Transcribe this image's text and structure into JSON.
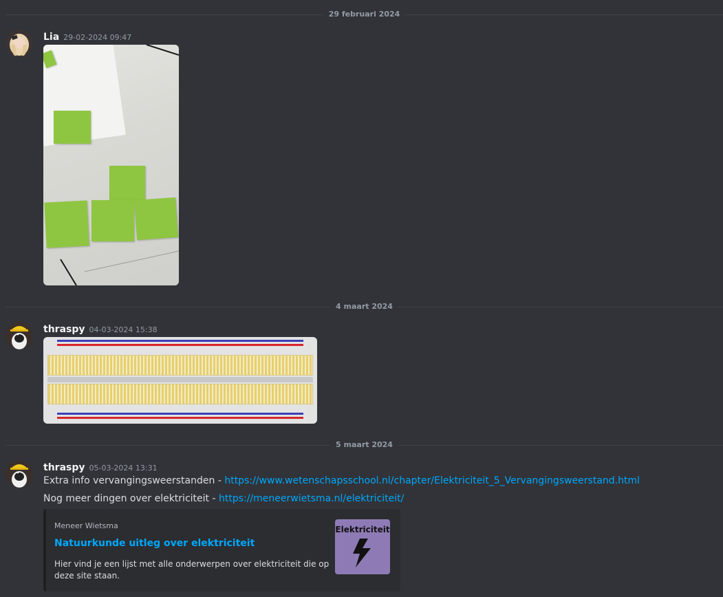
{
  "dividers": [
    "29 februari 2024",
    "4 maart 2024",
    "5 maart 2024"
  ],
  "messages": [
    {
      "author": "Lia",
      "timestamp": "29-02-2024 09:47",
      "avatar": "user-avatar",
      "attachment": "photo-sticky-notes"
    },
    {
      "author": "thraspy",
      "timestamp": "04-03-2024 15:38",
      "avatar": "penguin-hardhat-avatar",
      "attachment": "breadboard-image"
    },
    {
      "author": "thraspy",
      "timestamp": "05-03-2024 13:31",
      "avatar": "penguin-hardhat-avatar",
      "lines": [
        {
          "text": "Extra info vervangingsweerstanden - ",
          "link": "https://www.wetenschapsschool.nl/chapter/Elektriciteit_5_Vervangingsweerstand.html"
        },
        {
          "text": "Nog meer dingen over elektriciteit - ",
          "link": "https://meneerwietsma.nl/elektriciteit/"
        }
      ],
      "embed": {
        "provider": "Meneer Wietsma",
        "title": "Natuurkunde uitleg over elektriciteit",
        "description": "Hier vind je een lijst met alle onderwerpen over elektriciteit die op deze site staan.",
        "thumbnail_text": "Elektriciteit",
        "thumbnail_icon": "lightning-bolt-icon"
      }
    }
  ],
  "colors": {
    "background": "#313338",
    "link": "#00a8fc",
    "embed_bg": "#2b2d31",
    "thumbnail_bg": "#8e7bb5",
    "sticky_note": "#8ec641"
  }
}
